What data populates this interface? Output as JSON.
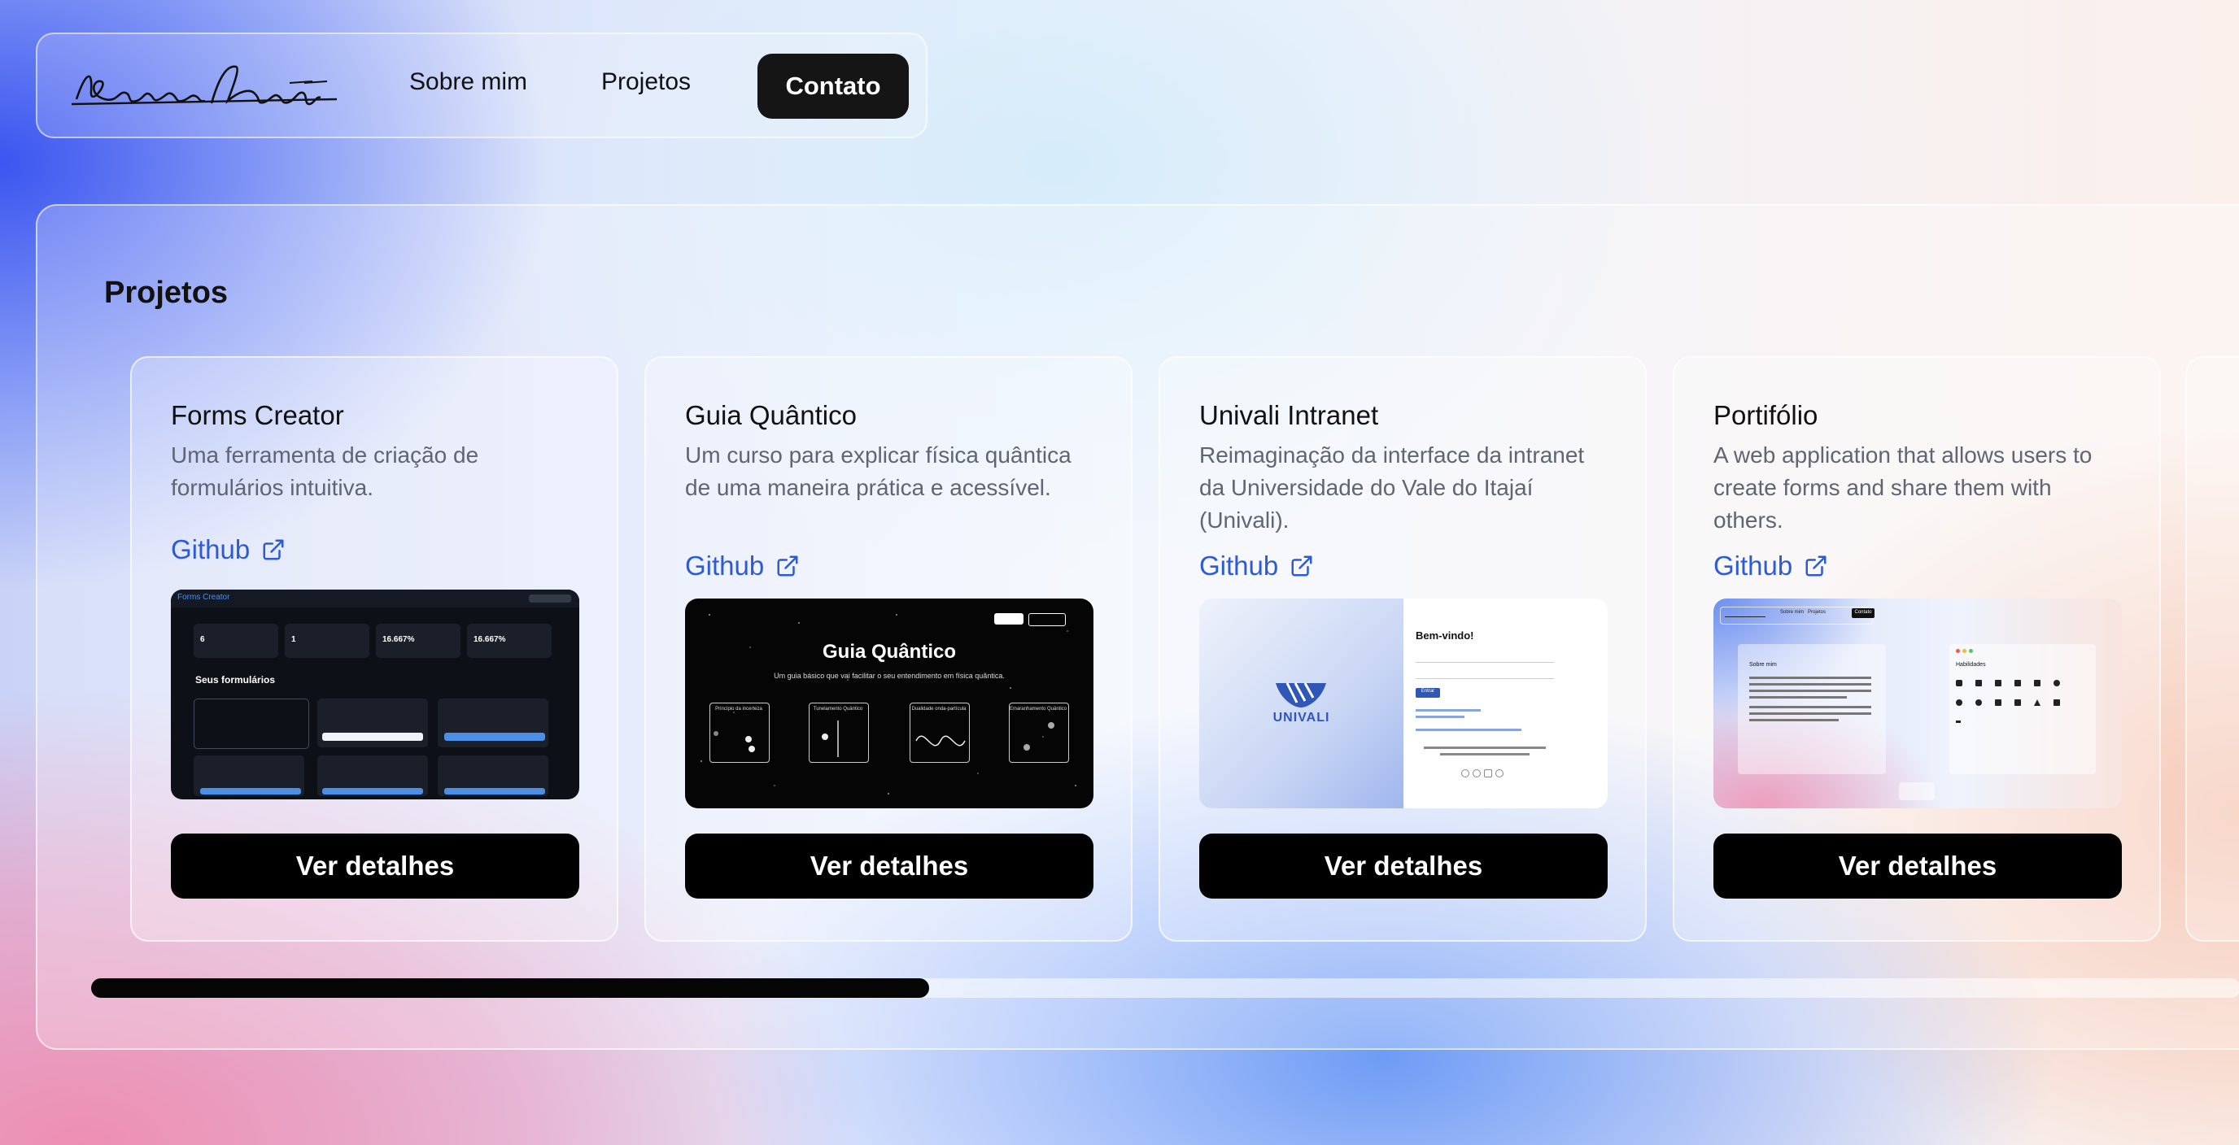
{
  "nav": {
    "logo_text": "Bruno Araff",
    "links": [
      "Sobre mim",
      "Projetos"
    ],
    "contact_label": "Contato"
  },
  "projects": {
    "title": "Projetos",
    "cards": [
      {
        "title": "Forms Creator",
        "description": "Uma ferramenta de criação de formulários intuitiva.",
        "link_label": "Github",
        "button_label": "Ver detalhes",
        "thumb": {
          "app_name": "Forms Creator",
          "stats": [
            "6",
            "1",
            "16.667%",
            "16.667%"
          ],
          "section": "Seus formulários"
        }
      },
      {
        "title": "Guia Quântico",
        "description": "Um curso para explicar física quântica de uma maneira prática e acessível.",
        "link_label": "Github",
        "button_label": "Ver detalhes",
        "thumb": {
          "heading": "Guia Quântico",
          "subtitle": "Um guia básico que vai facilitar o seu entendimento em física quântica.",
          "boxes": [
            "Princípio da incerteza",
            "Tunelamento Quântico",
            "Dualidade onda-partícula",
            "Emaranhamento Quântico"
          ]
        }
      },
      {
        "title": "Univali Intranet",
        "description": "Reimaginação da interface da intranet da Universidade do Vale do Itajaí (Univali).",
        "link_label": "Github",
        "button_label": "Ver detalhes",
        "thumb": {
          "brand": "UNIVALI",
          "welcome": "Bem-vindo!",
          "login_button": "Entrar"
        }
      },
      {
        "title": "Portifólio",
        "description": "A web application that allows users to create forms and share them with others.",
        "link_label": "Github",
        "button_label": "Ver detalhes",
        "thumb": {
          "nav": [
            "Sobre mim",
            "Projetos",
            "Contato"
          ],
          "left_title": "Sobre mim",
          "right_title": "Habilidades"
        }
      }
    ]
  },
  "scrollbar": {
    "position_fraction": 0.39
  },
  "colors": {
    "link": "#2d5ad6",
    "button_bg": "#000000",
    "contact_bg": "#151515",
    "description": "#5f6573"
  }
}
